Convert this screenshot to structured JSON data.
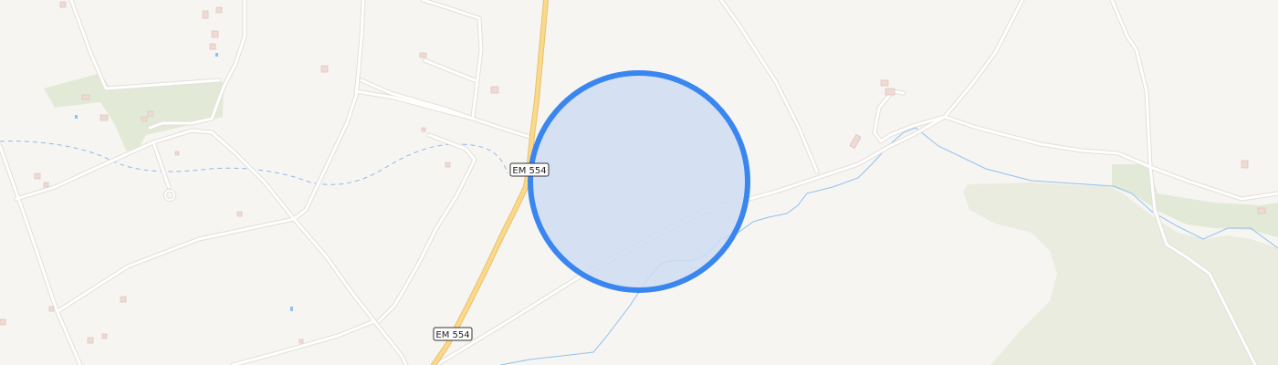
{
  "map": {
    "colors": {
      "background": "#f7f5f2",
      "minor_road": "#ffffff",
      "minor_road_casing": "#e3dfd9",
      "primary_road": "#fbd98a",
      "primary_road_casing": "#e8c06d",
      "water": "#8fc1f0",
      "water_dashed": "#8fb9e6",
      "vegetation": "#e9ecdf",
      "grass": "#e2ead7",
      "building": "#efdad5",
      "building_outline": "#e0c6bf",
      "accuracy_fill": "#cfdcf3",
      "accuracy_stroke": "#3a86f0"
    },
    "road_labels": [
      {
        "id": "em554-upper",
        "text": "EM 554"
      },
      {
        "id": "em554-lower",
        "text": "EM 554"
      }
    ],
    "location_marker": {
      "type": "accuracy-circle",
      "icon": "location-accuracy-circle-icon"
    }
  }
}
